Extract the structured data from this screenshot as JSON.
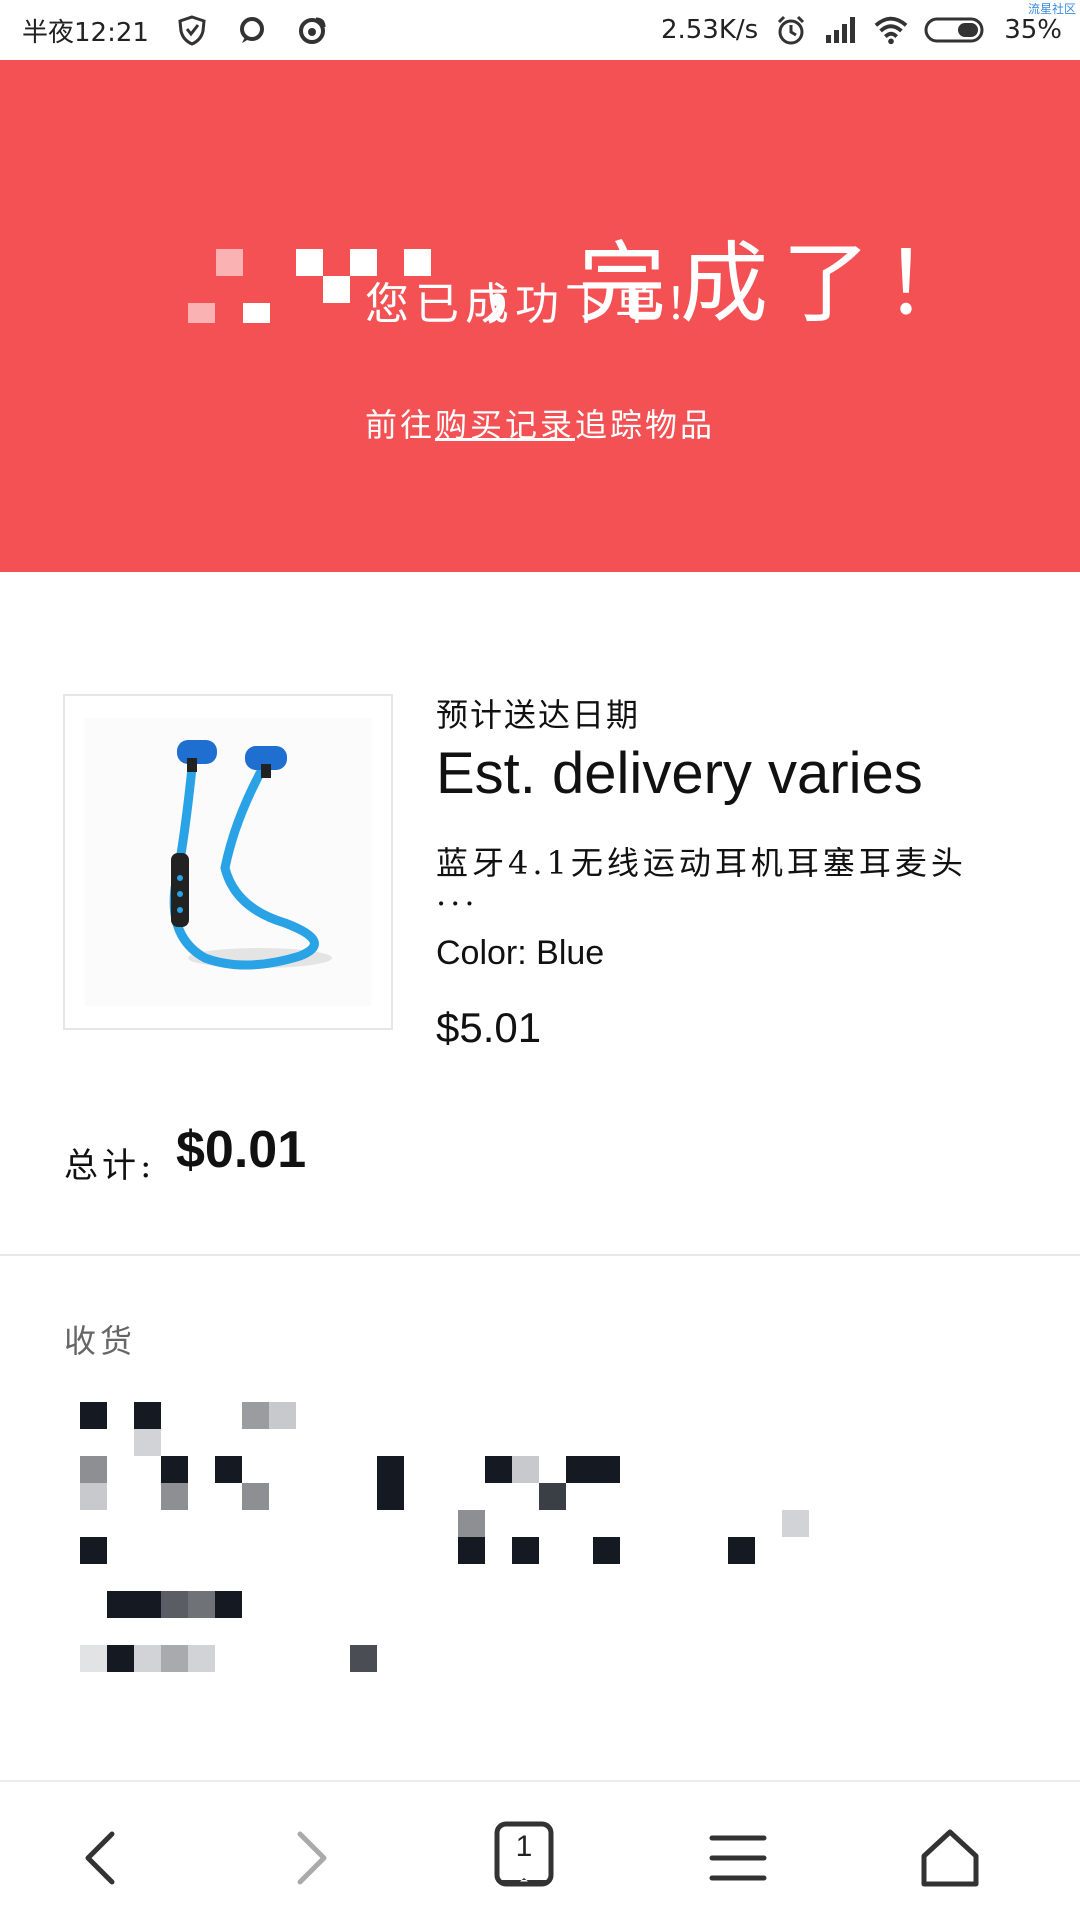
{
  "status_bar": {
    "time": "半夜12:21",
    "network_speed": "2.53K/s",
    "battery": "35%",
    "corner_tag": "流星社区"
  },
  "hero": {
    "title": "，完成了！",
    "subtitle": "您已成功下单！",
    "link_prefix": "前往",
    "link_text": "购买记录",
    "link_suffix": "追踪物品"
  },
  "order": {
    "delivery_label": "预计送达日期",
    "delivery_value": "Est. delivery varies",
    "item_title": "蓝牙4.1无线运动耳机耳塞耳麦头",
    "item_title_ellipsis": "...",
    "item_variant": "Color: Blue",
    "item_price": "$5.01",
    "total_label": "总计:",
    "total_value": "$0.01"
  },
  "shipping": {
    "label": "收货"
  },
  "bottom_nav": {
    "tab_count": "1"
  },
  "colors": {
    "hero_bg": "#f45154",
    "headphones": "#2aa2e6"
  },
  "icons": [
    "shield-icon",
    "chat-icon",
    "weibo-icon",
    "alarm-icon",
    "signal-icon",
    "wifi-icon",
    "battery-icon",
    "back-icon",
    "forward-icon",
    "tabs-icon",
    "menu-icon",
    "home-icon"
  ]
}
